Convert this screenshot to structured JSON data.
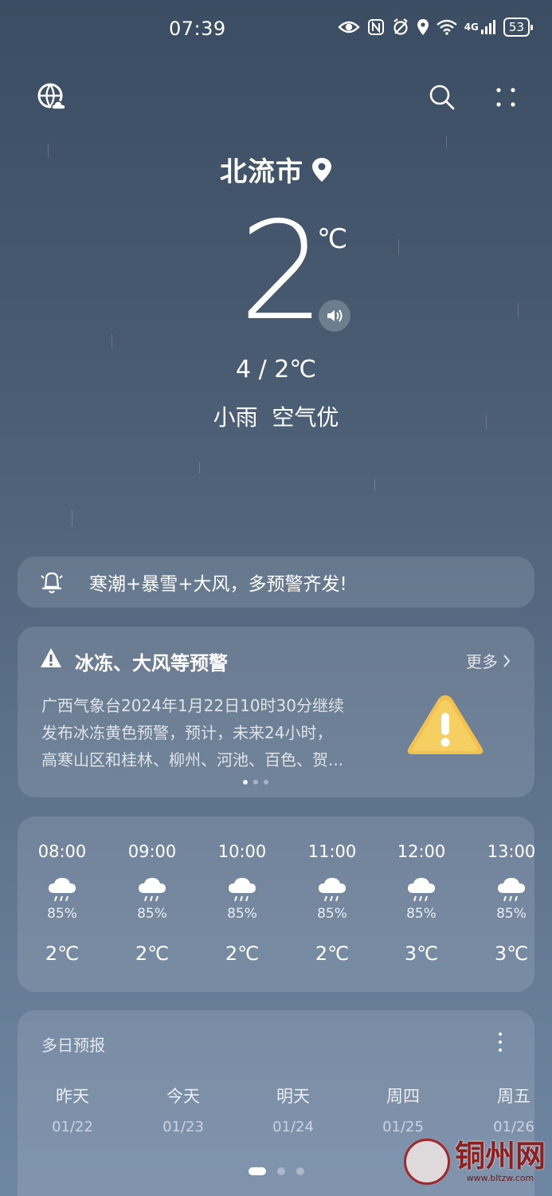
{
  "status_bar": {
    "time": "07:39",
    "network": "4G",
    "battery": "53"
  },
  "header": {
    "city": "北流市"
  },
  "current": {
    "temp": "2",
    "unit": "℃",
    "range": "4 / 2℃",
    "condition": "小雨  空气优"
  },
  "banner": {
    "text": "寒潮+暴雪+大风，多预警齐发!"
  },
  "alert": {
    "title": "冰冻、大风等预警",
    "more": "更多",
    "lines": [
      "广西气象台2024年1月22日10时30分继续",
      "发布冰冻黄色预警，预计，未来24小时，",
      "高寒山区和桂林、柳州、河池、百色、贺..."
    ]
  },
  "hourly": [
    {
      "time": "08:00",
      "prob": "85%",
      "temp": "2℃",
      "icon": "rain-cloud-icon"
    },
    {
      "time": "09:00",
      "prob": "85%",
      "temp": "2℃",
      "icon": "rain-cloud-icon"
    },
    {
      "time": "10:00",
      "prob": "85%",
      "temp": "2℃",
      "icon": "rain-cloud-icon"
    },
    {
      "time": "11:00",
      "prob": "85%",
      "temp": "2℃",
      "icon": "rain-cloud-icon"
    },
    {
      "time": "12:00",
      "prob": "85%",
      "temp": "3℃",
      "icon": "rain-cloud-icon"
    },
    {
      "time": "13:00",
      "prob": "85%",
      "temp": "3℃",
      "icon": "rain-cloud-icon"
    }
  ],
  "daily": {
    "title": "多日预报",
    "days": [
      {
        "name": "昨天",
        "date": "01/22"
      },
      {
        "name": "今天",
        "date": "01/23"
      },
      {
        "name": "明天",
        "date": "01/24"
      },
      {
        "name": "周四",
        "date": "01/25"
      },
      {
        "name": "周五",
        "date": "01/26"
      }
    ]
  },
  "watermark": {
    "text": "铜州网",
    "url": "www.bltzw.com"
  }
}
